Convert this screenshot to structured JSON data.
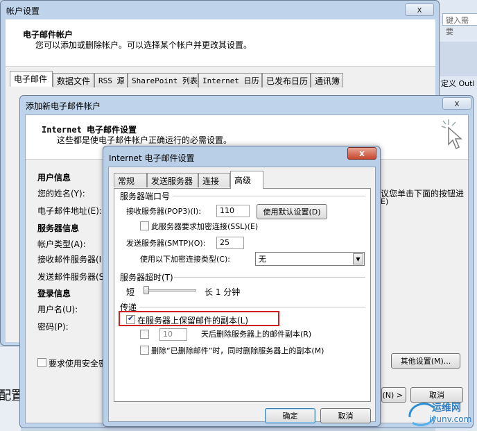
{
  "account_settings": {
    "title": "帐户设置",
    "heading": "电子邮件帐户",
    "subheading": "您可以添加或删除帐户。可以选择某个帐户并更改其设置。",
    "tabs": [
      "电子邮件",
      "数据文件",
      "RSS 源",
      "SharePoint 列表",
      "Internet 日历",
      "已发布日历",
      "通讯簿"
    ],
    "close_label": "x"
  },
  "background_app": {
    "search_placeholder": "键入需要",
    "ribbon_text": "定义 Outl",
    "side_text": "配置"
  },
  "add_account": {
    "title": "添加新电子邮件帐户",
    "heading": "Internet 电子邮件设置",
    "subheading": "这些都是使电子邮件帐户正确运行的必需设置。",
    "close_label": "x",
    "right_hint": "议您单击下面的按钮进",
    "right_hint2": "E)",
    "sections": {
      "user_info": "用户信息",
      "name_label": "您的姓名(Y):",
      "email_label": "电子邮件地址(E):",
      "server_info": "服务器信息",
      "account_type_label": "帐户类型(A):",
      "incoming_label": "接收邮件服务器(I",
      "outgoing_label": "发送邮件服务器(S",
      "login_info": "登录信息",
      "username_label": "用户名(U):",
      "password_label": "密码(P):",
      "spa_label": "要求使用安全密"
    },
    "more_settings": "其他设置(M)...",
    "next": "(N) >",
    "cancel": "取消"
  },
  "internet_settings": {
    "title": "Internet 电子邮件设置",
    "close_label": "x",
    "tabs": [
      "常规",
      "发送服务器",
      "连接",
      "高级"
    ],
    "ports_group": "服务器端口号",
    "incoming_label": "接收服务器(POP3)(I):",
    "incoming_port": "110",
    "default_btn": "使用默认设置(D)",
    "ssl_label": "此服务器要求加密连接(SSL)(E)",
    "outgoing_label": "发送服务器(SMTP)(O):",
    "outgoing_port": "25",
    "encrypt_label": "使用以下加密连接类型(C):",
    "encrypt_value": "无",
    "timeout_group": "服务器超时(T)",
    "timeout_short": "短",
    "timeout_long": "长 1 分钟",
    "timeout_level": 0.0,
    "delivery_group": "传递",
    "leave_copy_label": "在服务器上保留邮件的副本(L)",
    "remove_after_days": "10",
    "remove_after_label": "天后删除服务器上的邮件副本(R)",
    "remove_deleted_label": "删除“已删除邮件”时，同时删除服务器上的副本(M)",
    "ok": "确定",
    "cancel": "取消"
  },
  "watermark": {
    "line1": "运维网",
    "line2": "iyunv.com"
  },
  "colors": {
    "highlight": "#d11f1f",
    "window_frame": "#bfd3ea"
  }
}
